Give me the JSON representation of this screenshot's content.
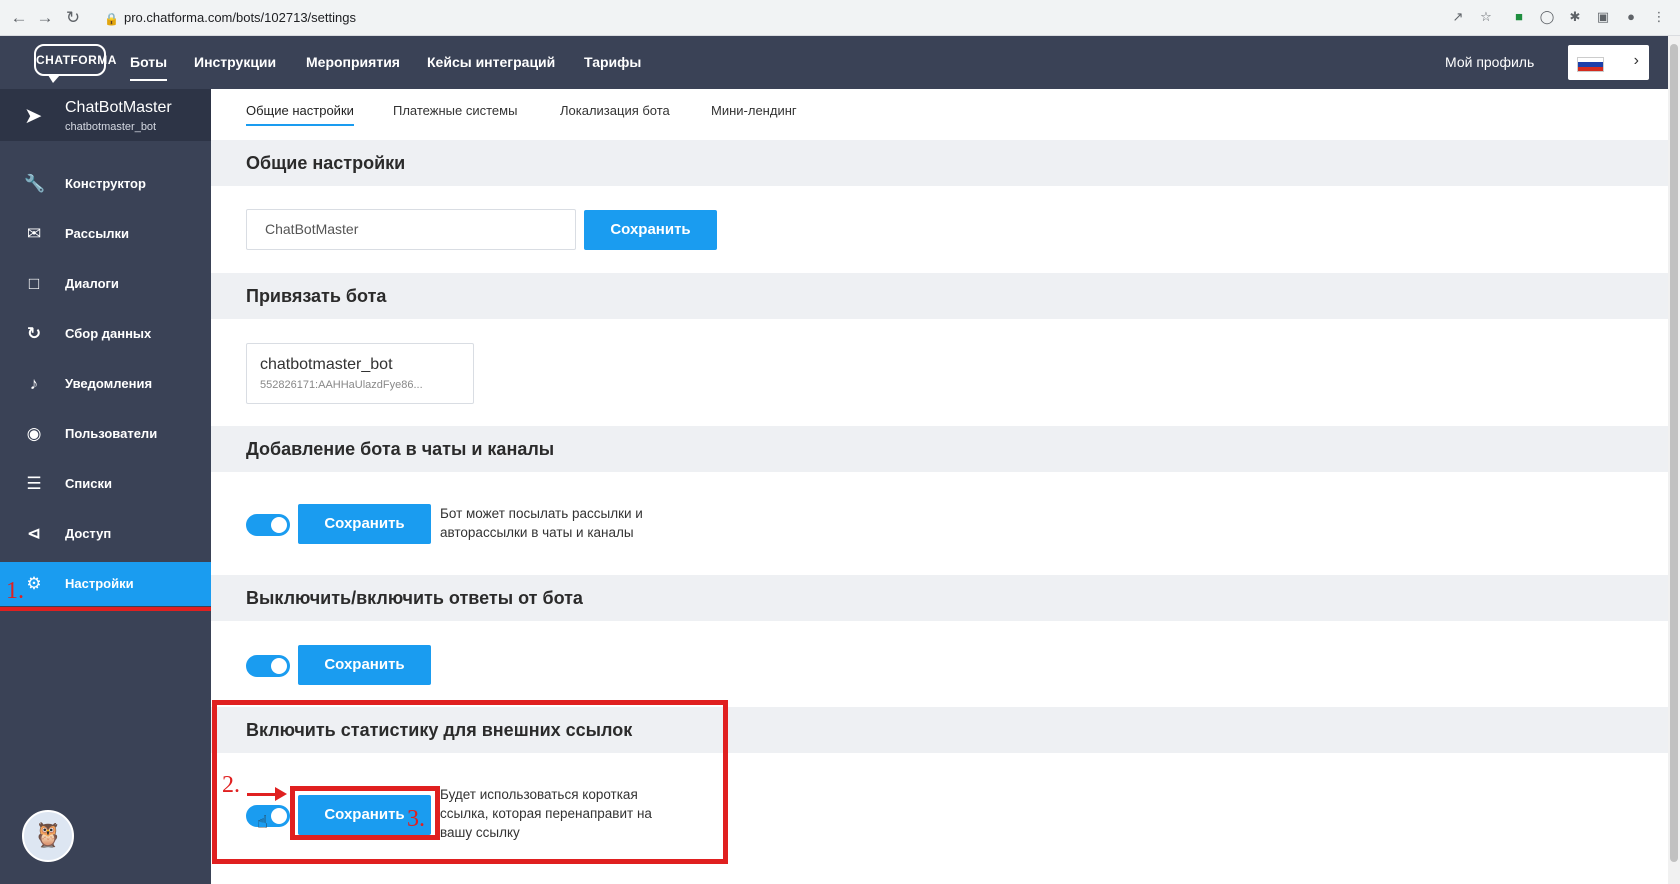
{
  "browser": {
    "url": "pro.chatforma.com/bots/102713/settings",
    "back_icon": "arrow-left-icon",
    "forward_icon": "arrow-right-icon",
    "reload_icon": "reload-icon"
  },
  "topbar": {
    "logo": "CHATFORMA",
    "nav": [
      "Боты",
      "Инструкции",
      "Мероприятия",
      "Кейсы интеграций",
      "Тарифы"
    ],
    "active_nav": "Боты",
    "profile": "Мой профиль"
  },
  "sidebar": {
    "bot_name": "ChatBotMaster",
    "bot_username": "chatbotmaster_bot",
    "items": [
      {
        "label": "Конструктор",
        "icon": "wrench-icon"
      },
      {
        "label": "Рассылки",
        "icon": "envelope-icon"
      },
      {
        "label": "Диалоги",
        "icon": "chat-icon"
      },
      {
        "label": "Сбор данных",
        "icon": "refresh-circle-icon"
      },
      {
        "label": "Уведомления",
        "icon": "bell-icon"
      },
      {
        "label": "Пользователи",
        "icon": "users-icon"
      },
      {
        "label": "Списки",
        "icon": "list-icon"
      },
      {
        "label": "Доступ",
        "icon": "share-icon"
      },
      {
        "label": "Настройки",
        "icon": "gear-icon"
      }
    ],
    "active_item": "Настройки"
  },
  "tabs": [
    "Общие настройки",
    "Платежные системы",
    "Локализация бота",
    "Мини-лендинг"
  ],
  "active_tab": "Общие настройки",
  "sections": {
    "general": {
      "title": "Общие настройки",
      "input_value": "ChatBotMaster",
      "save": "Сохранить"
    },
    "link": {
      "title": "Привязать бота",
      "bot_username": "chatbotmaster_bot",
      "token": "552826171:AAHHaUlazdFye86..."
    },
    "chats": {
      "title": "Добавление бота в чаты и каналы",
      "save": "Сохранить",
      "toggle_on": true,
      "desc": "Бот может посылать рассылки и авторассылки в чаты и каналы"
    },
    "replies": {
      "title": "Выключить/включить ответы от бота",
      "save": "Сохранить",
      "toggle_on": true
    },
    "stats": {
      "title": "Включить статистику для внешних ссылок",
      "save": "Сохранить",
      "toggle_on": true,
      "desc": "Будет использоваться короткая ссылка, которая перенаправит на вашу ссылку"
    }
  },
  "annotations": {
    "step1": "1.",
    "step2": "2.",
    "step3": "3."
  },
  "colors": {
    "accent": "#1a9cf0",
    "sidebar": "#3a4256",
    "annotation": "#e02020"
  }
}
